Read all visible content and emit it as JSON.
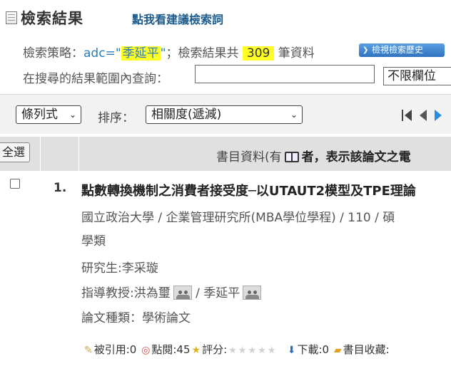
{
  "header": {
    "title": "檢索結果",
    "suggest_link": "點我看建議檢索詞"
  },
  "strategy": {
    "label": "檢索策略：",
    "query_field": "adc=",
    "query_open": "\"",
    "query_value": "季延平",
    "query_close": "\"",
    "result_prefix": "；檢索結果共",
    "count": "309",
    "result_suffix": "筆資料",
    "history_button": "檢視檢索歷史"
  },
  "within": {
    "label": "在搜尋的結果範圍內查詢：",
    "input_value": "",
    "field_select": "不限欄位"
  },
  "toolbar": {
    "view_select": "條列式",
    "sort_label": "排序：",
    "sort_select": "相關度(遞減)"
  },
  "table_header": {
    "select_all": "全選",
    "column_prefix": "書目資料(有",
    "column_suffix": "者，表示該論文之電"
  },
  "result": {
    "number": "1.",
    "title": "點數轉換機制之消費者接受度─以UTAUT2模型及TPE理論",
    "institution": "國立政治大學 / 企業管理研究所(MBA學位學程) / 110 / 碩",
    "subject": "學類",
    "student": "研究生:李采璇",
    "advisor_label": "指導教授:洪為璽",
    "advisor_sep": "/ 季延平",
    "thesis_type": "論文種類：學術論文",
    "stats": {
      "cited": "被引用:0",
      "views": "點閱:45",
      "rating": "評分:",
      "downloads": "下載:0",
      "bookmarks": "書目收藏:"
    }
  }
}
